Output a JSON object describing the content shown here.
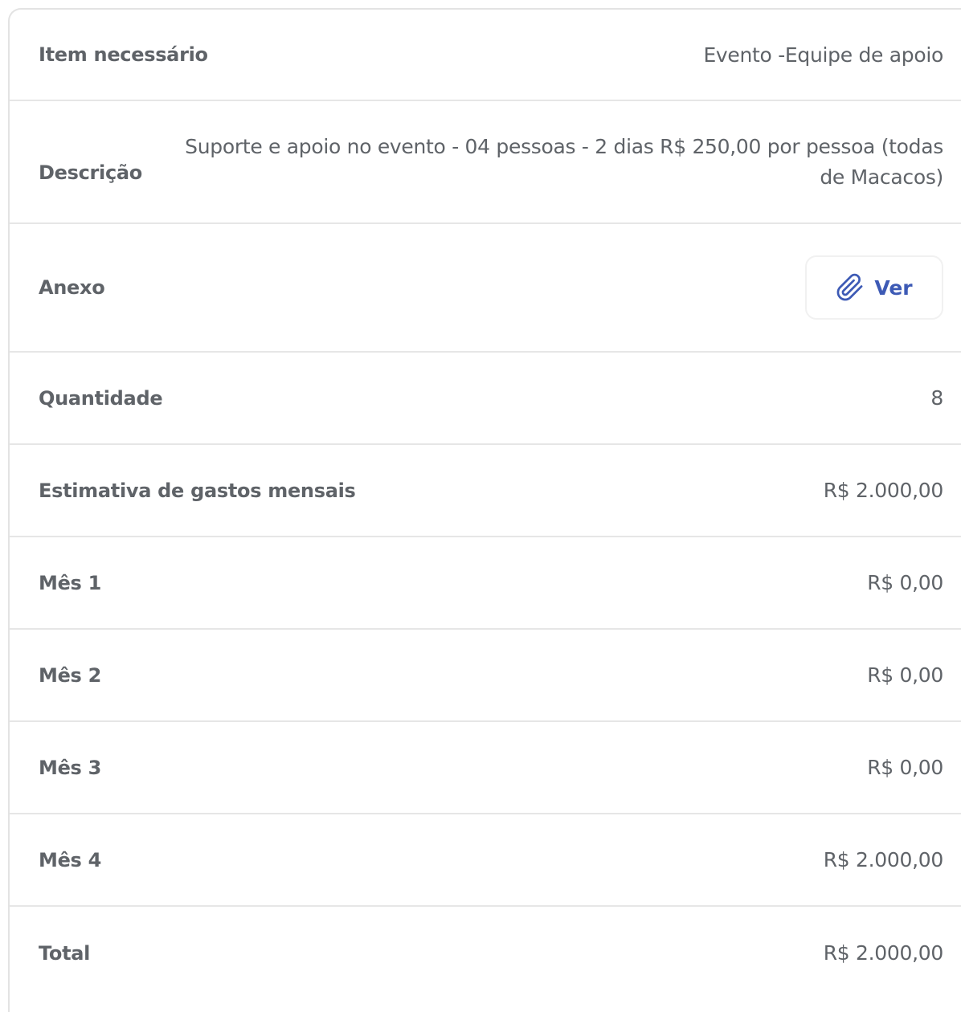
{
  "rows": {
    "item": {
      "label": "Item necessário",
      "value": "Evento -Equipe de apoio"
    },
    "descricao": {
      "label": "Descrição",
      "value": "Suporte e apoio no evento - 04 pessoas - 2 dias R$ 250,00 por pessoa (todas de Macacos)"
    },
    "anexo": {
      "label": "Anexo",
      "button_label": "Ver",
      "button_icon": "paperclip-icon"
    },
    "quantidade": {
      "label": "Quantidade",
      "value": "8"
    },
    "estimativa": {
      "label": "Estimativa de gastos mensais",
      "value": "R$ 2.000,00"
    },
    "mes1": {
      "label": "Mês 1",
      "value": "R$ 0,00"
    },
    "mes2": {
      "label": "Mês 2",
      "value": "R$ 0,00"
    },
    "mes3": {
      "label": "Mês 3",
      "value": "R$ 0,00"
    },
    "mes4": {
      "label": "Mês 4",
      "value": "R$ 2.000,00"
    },
    "total": {
      "label": "Total",
      "value": "R$ 2.000,00"
    }
  },
  "colors": {
    "text": "#5f6368",
    "accent": "#3d5ab5",
    "divider": "#e6e6e6"
  }
}
